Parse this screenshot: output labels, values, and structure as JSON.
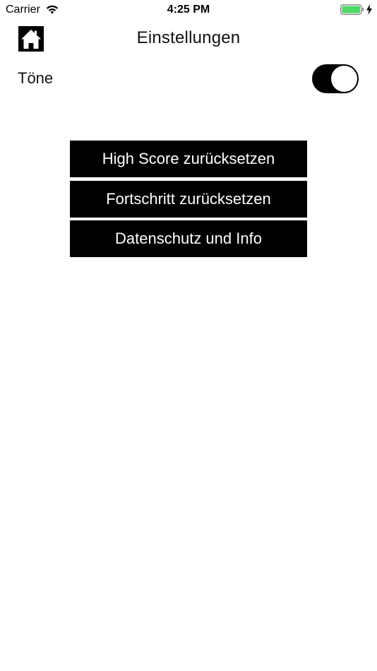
{
  "status_bar": {
    "carrier": "Carrier",
    "time": "4:25 PM",
    "icons": [
      "wifi-icon",
      "battery-icon",
      "charging-icon"
    ],
    "battery_color": "#4cd964"
  },
  "header": {
    "home_icon": "home-icon",
    "title": "Einstellungen"
  },
  "settings": {
    "sound_label": "Töne",
    "sound_enabled": true
  },
  "actions": {
    "reset_highscore": "High Score zurücksetzen",
    "reset_progress": "Fortschritt zurücksetzen",
    "privacy_info": "Datenschutz und Info"
  },
  "colors": {
    "button_background": "#000000",
    "button_text": "#ffffff",
    "background": "#ffffff"
  }
}
